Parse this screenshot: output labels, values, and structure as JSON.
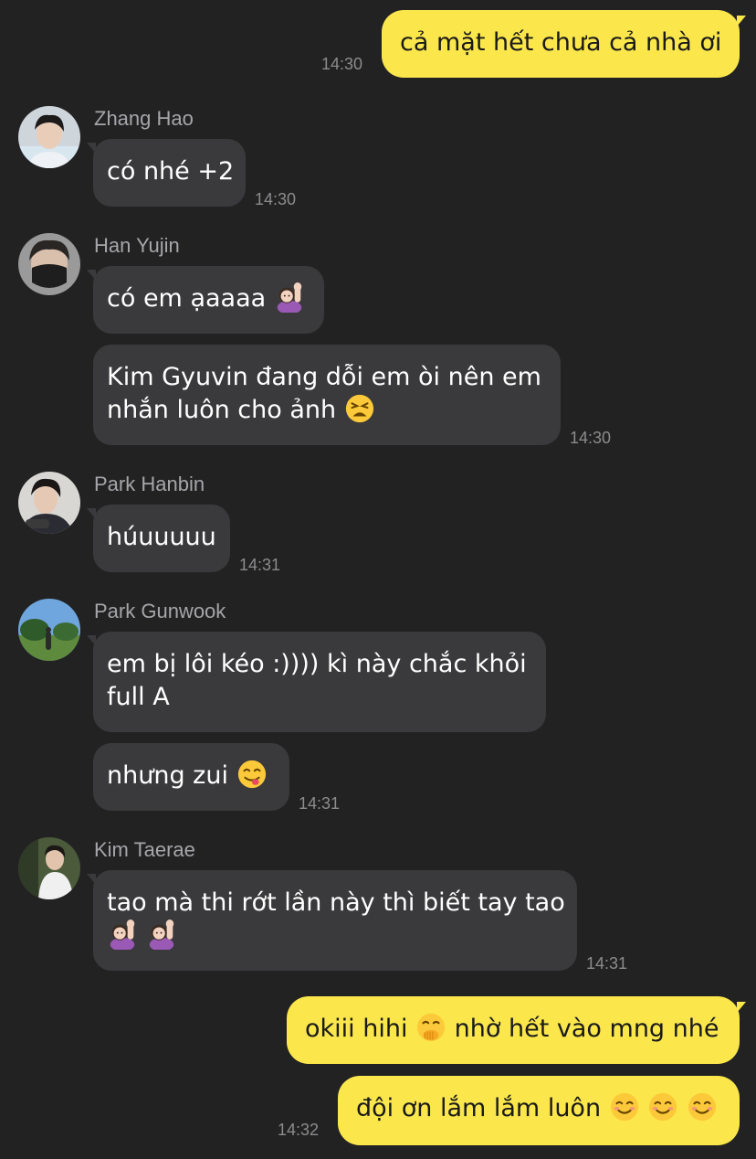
{
  "messages": [
    {
      "text": "cả mặt hết chưa cả nhà ơi",
      "time": "14:30"
    },
    {
      "sender": "Zhang Hao",
      "text": "có nhé +2",
      "time": "14:30"
    },
    {
      "sender": "Han Yujin",
      "text": "có em ạaaaa",
      "emoji": "person-raising-hand-emoji"
    },
    {
      "line1": "Kim Gyuvin đang dỗi em òi nên em",
      "line2": "nhắn luôn cho ảnh",
      "emoji": "tired-face-emoji",
      "time": "14:30"
    },
    {
      "sender": "Park Hanbin",
      "text": "húuuuuu",
      "time": "14:31"
    },
    {
      "sender": "Park Gunwook",
      "line1": "em bị lôi kéo :)))) kì này chắc khỏi",
      "line2": "full A"
    },
    {
      "text": "nhưng zui",
      "emoji": "yum-face-emoji",
      "time": "14:31"
    },
    {
      "sender": "Kim Taerae",
      "line1": "tao mà thi rớt lần này thì biết tay tao",
      "emoji": "person-raising-hand-emoji",
      "time": "14:31"
    },
    {
      "text1": "okiii hihi",
      "emoji": "hand-over-mouth-emoji",
      "text2": "nhờ hết vào mng nhé"
    },
    {
      "text": "đội ơn lắm lắm luôn",
      "emoji": "smiling-face-emoji",
      "time": "14:32"
    }
  ],
  "colors": {
    "background": "#222223",
    "incoming_bubble": "#3a3a3c",
    "outgoing_bubble": "#fbe74c",
    "timestamp": "#8c8c8e",
    "sender_name": "#a6a6aa"
  }
}
